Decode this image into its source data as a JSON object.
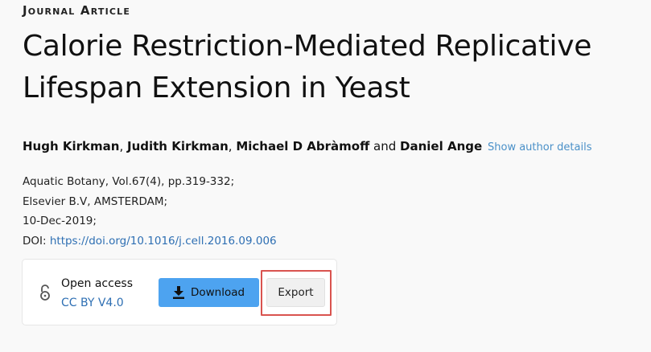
{
  "article": {
    "eyebrow": "Journal Article",
    "title": "Calorie Restriction-Mediated Replicative Lifespan Extension in Yeast",
    "authors": [
      "Hugh Kirkman",
      "Judith Kirkman",
      "Michael D Abràmoff",
      "Daniel Ange"
    ],
    "author_sep": ", ",
    "author_and": " and ",
    "show_details": "Show author details",
    "meta": {
      "journal": "Aquatic Botany, Vol.67(4), pp.319-332;",
      "publisher": "Elsevier B.V, AMSTERDAM;",
      "date": "10-Dec-2019;",
      "doi_label": "DOI: ",
      "doi_link": "https://doi.org/10.1016/j.cell.2016.09.006"
    }
  },
  "access": {
    "label": "Open access",
    "license": "CC BY V4.0",
    "lock_icon": "open-lock-icon",
    "download_label": "Download",
    "download_icon": "download-icon",
    "export_label": "Export"
  },
  "colors": {
    "accent_blue": "#4da3f0",
    "link_blue": "#2e6fb3",
    "highlight_red": "#d9534f"
  }
}
